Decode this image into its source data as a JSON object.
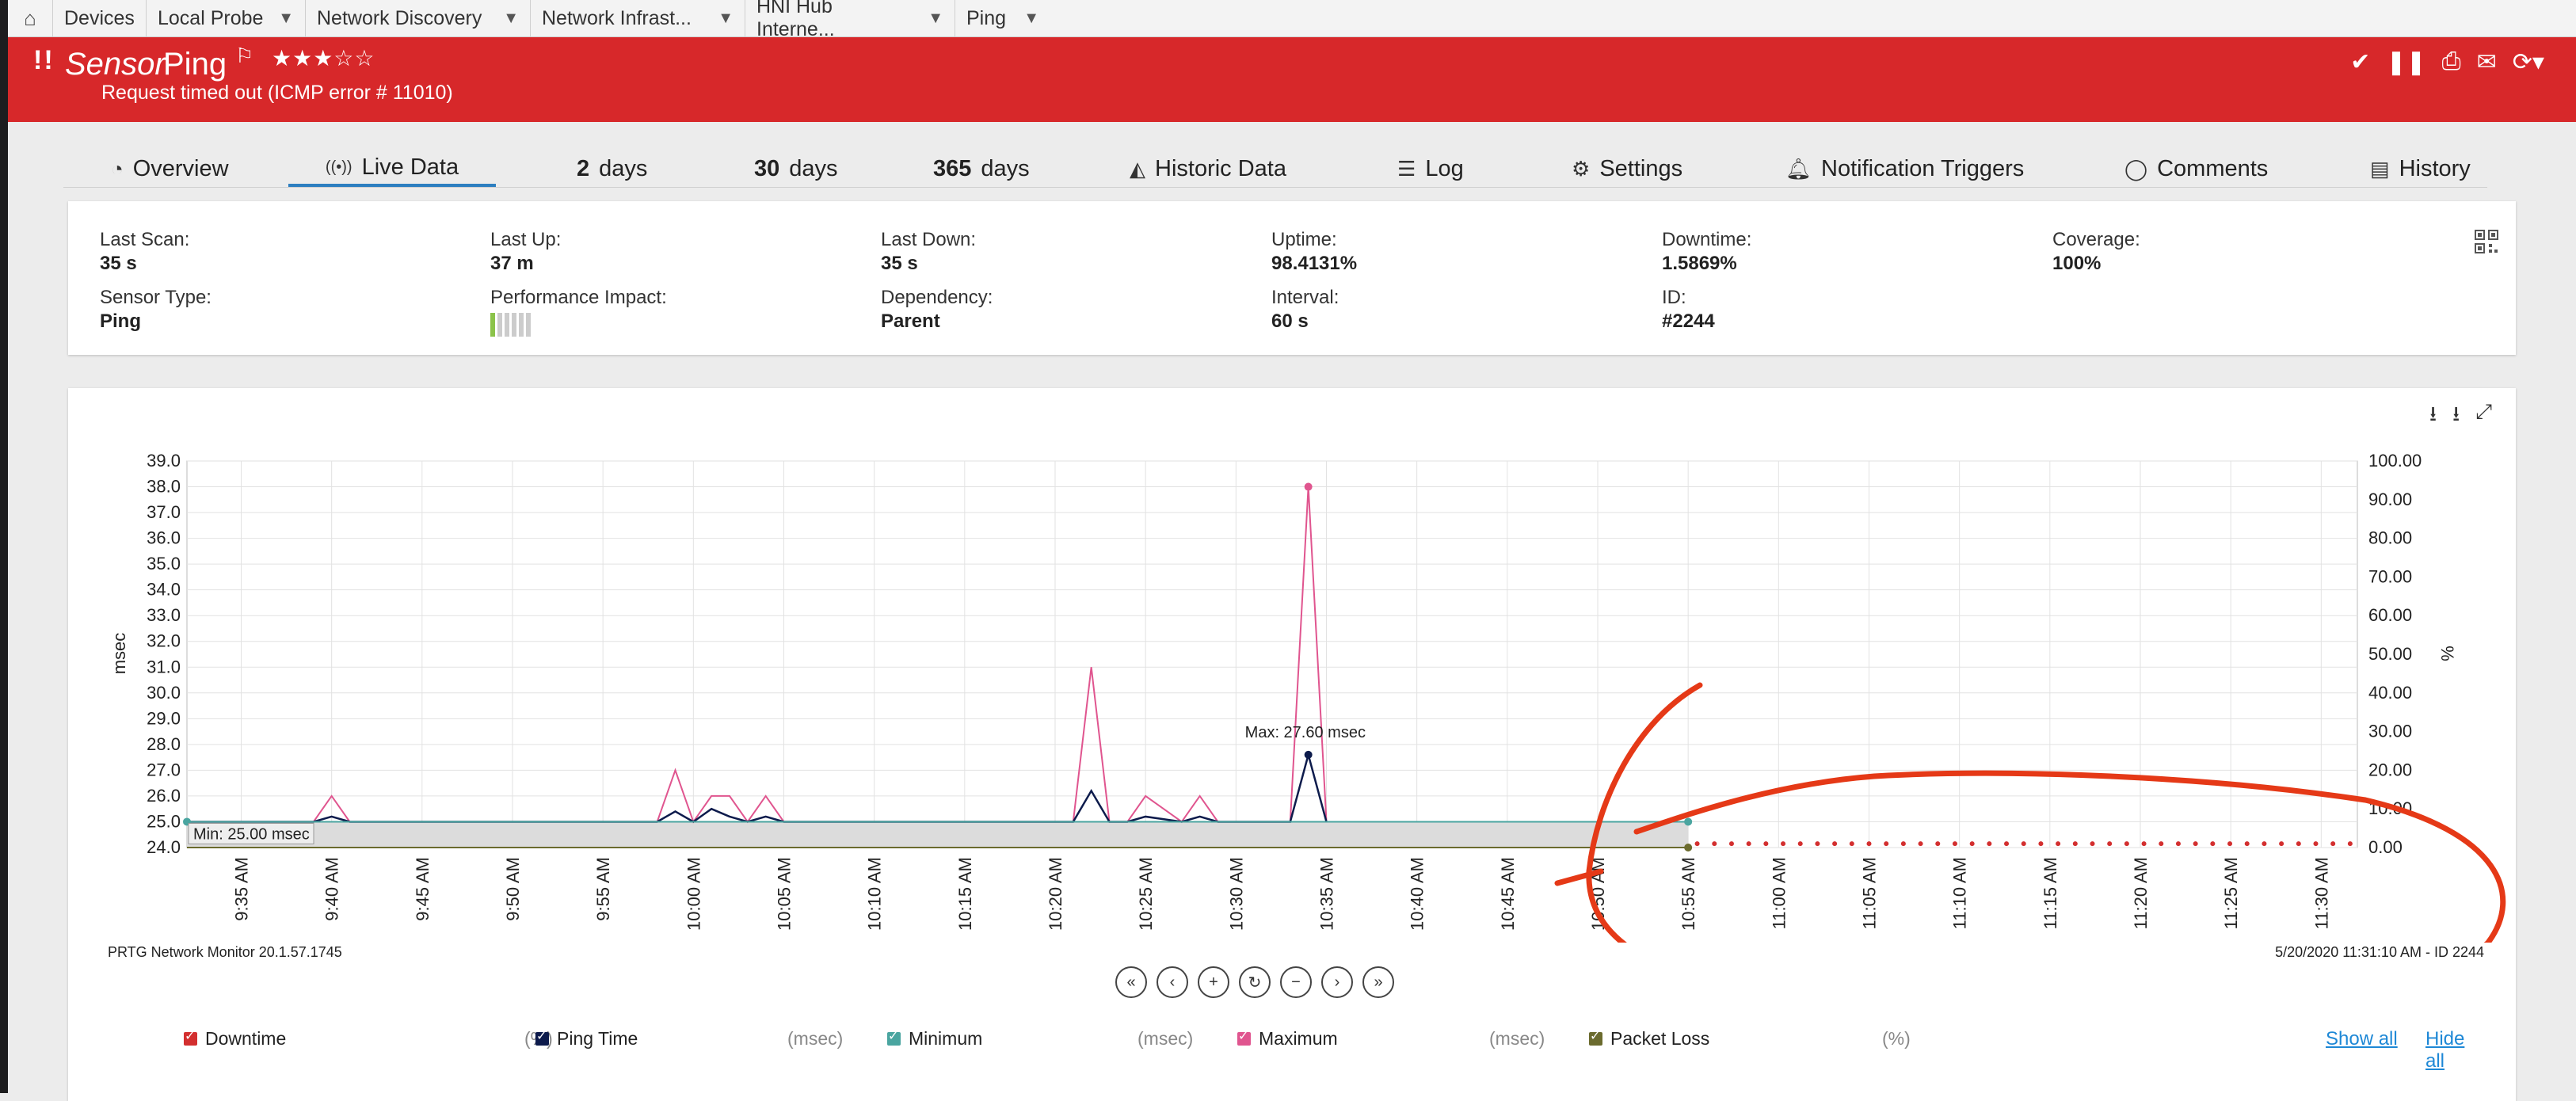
{
  "breadcrumb": {
    "items": [
      {
        "label": "Devices",
        "has_menu": false
      },
      {
        "label": "Local Probe",
        "has_menu": true
      },
      {
        "label": "Network Discovery",
        "has_menu": true
      },
      {
        "label": "Network Infrast...",
        "has_menu": true
      },
      {
        "label": "HNI Hub Interne...",
        "has_menu": true
      },
      {
        "label": "Ping",
        "has_menu": true
      }
    ]
  },
  "sensor": {
    "alert": "!!",
    "kind": "Sensor",
    "name": "Ping",
    "stars": "★★★☆☆",
    "status_message": "Request timed out (ICMP error # 11010)"
  },
  "tabs": [
    {
      "label": "Overview",
      "icon": "gauge-icon"
    },
    {
      "label": "Live Data",
      "icon": "broadcast-icon"
    },
    {
      "num": "2",
      "label": "days"
    },
    {
      "num": "30",
      "label": "days"
    },
    {
      "num": "365",
      "label": "days"
    },
    {
      "label": "Historic Data",
      "icon": "area-chart-icon"
    },
    {
      "label": "Log",
      "icon": "list-icon"
    },
    {
      "label": "Settings",
      "icon": "gear-icon"
    },
    {
      "label": "Notification Triggers",
      "icon": "bell-icon"
    },
    {
      "label": "Comments",
      "icon": "comment-icon"
    },
    {
      "label": "History",
      "icon": "history-icon"
    }
  ],
  "info": {
    "last_scan": {
      "label": "Last Scan:",
      "value": "35 s"
    },
    "last_up": {
      "label": "Last Up:",
      "value": "37 m"
    },
    "last_down": {
      "label": "Last Down:",
      "value": "35 s"
    },
    "uptime": {
      "label": "Uptime:",
      "value": "98.4131%"
    },
    "downtime": {
      "label": "Downtime:",
      "value": "1.5869%"
    },
    "coverage": {
      "label": "Coverage:",
      "value": "100%"
    },
    "sensor_type": {
      "label": "Sensor Type:",
      "value": "Ping"
    },
    "performance_impact": {
      "label": "Performance Impact:",
      "level": 1,
      "of": 6
    },
    "dependency": {
      "label": "Dependency:",
      "value": "Parent"
    },
    "interval": {
      "label": "Interval:",
      "value": "60 s"
    },
    "id": {
      "label": "ID:",
      "value": "#2244"
    }
  },
  "graph": {
    "footer_left": "PRTG Network Monitor 20.1.57.1745",
    "footer_right": "5/20/2020 11:31:10 AM - ID 2244",
    "legend": [
      {
        "name": "Downtime",
        "unit": "(%)",
        "color": "#d32f2f"
      },
      {
        "name": "Ping Time",
        "unit": "(msec)",
        "color": "#0d1b4c"
      },
      {
        "name": "Minimum",
        "unit": "(msec)",
        "color": "#4aa5a0"
      },
      {
        "name": "Maximum",
        "unit": "(msec)",
        "color": "#e0558f"
      },
      {
        "name": "Packet Loss",
        "unit": "(%)",
        "color": "#6b6b2e"
      }
    ],
    "show_all": "Show all",
    "hide_all": "Hide all"
  },
  "chart_data": {
    "type": "line",
    "ylabel": "msec",
    "y2label": "%",
    "ylim": [
      24.0,
      39.0
    ],
    "y2lim": [
      0,
      100
    ],
    "yticks": [
      "24.0",
      "25.0",
      "26.0",
      "27.0",
      "28.0",
      "29.0",
      "30.0",
      "31.0",
      "32.0",
      "33.0",
      "34.0",
      "35.0",
      "36.0",
      "37.0",
      "38.0",
      "39.0"
    ],
    "y2ticks": [
      "0.00",
      "10.00",
      "20.00",
      "30.00",
      "40.00",
      "50.00",
      "60.00",
      "70.00",
      "80.00",
      "90.00",
      "100.00"
    ],
    "xticks": [
      "9:35 AM",
      "9:40 AM",
      "9:45 AM",
      "9:50 AM",
      "9:55 AM",
      "10:00 AM",
      "10:05 AM",
      "10:10 AM",
      "10:15 AM",
      "10:20 AM",
      "10:25 AM",
      "10:30 AM",
      "10:35 AM",
      "10:40 AM",
      "10:45 AM",
      "10:50 AM",
      "10:55 AM",
      "11:00 AM",
      "11:05 AM",
      "11:10 AM",
      "11:15 AM",
      "11:20 AM",
      "11:25 AM",
      "11:30 AM"
    ],
    "x_minutes_start": 572,
    "x_minutes_end": 692,
    "series": [
      {
        "name": "Maximum",
        "color": "#e0558f",
        "x": [
          572,
          579,
          580,
          581,
          598,
          599,
          600,
          601,
          602,
          603,
          604,
          605,
          621,
          622,
          623,
          624,
          625,
          627,
          628,
          629,
          633,
          634,
          635,
          647,
          648,
          649,
          650,
          651
        ],
        "y": [
          25,
          25,
          26,
          25,
          25,
          27,
          25,
          26,
          26,
          25,
          26,
          25,
          25,
          31,
          25,
          25,
          26,
          25,
          26,
          25,
          25,
          38,
          25,
          25,
          25,
          25,
          25,
          25
        ]
      },
      {
        "name": "Ping Time",
        "color": "#0d1b4c",
        "x": [
          572,
          579,
          580,
          581,
          598,
          599,
          600,
          601,
          602,
          603,
          604,
          605,
          621,
          622,
          623,
          624,
          625,
          627,
          628,
          629,
          633,
          634,
          635
        ],
        "y": [
          25,
          25,
          25.2,
          25,
          25,
          25.4,
          25,
          25.5,
          25.2,
          25,
          25.2,
          25,
          25,
          26.2,
          25,
          25,
          25.2,
          25,
          25.2,
          25,
          25,
          27.6,
          25
        ]
      },
      {
        "name": "Minimum",
        "color": "#4aa5a0",
        "x": [
          572,
          655
        ],
        "y": [
          25,
          25
        ]
      },
      {
        "name": "Packet Loss",
        "color": "#6b6b2e",
        "x": [
          572,
          655
        ],
        "y": [
          0,
          0
        ],
        "axis": "y2"
      },
      {
        "name": "Downtime",
        "color": "#d32f2f",
        "x": [
          655,
          692
        ],
        "y": [
          1,
          1
        ],
        "axis": "y2",
        "style": "dotted"
      }
    ],
    "annotations": [
      {
        "text": "Max: 27.60 msec"
      },
      {
        "text": "Min: 25.00 msec"
      }
    ]
  }
}
